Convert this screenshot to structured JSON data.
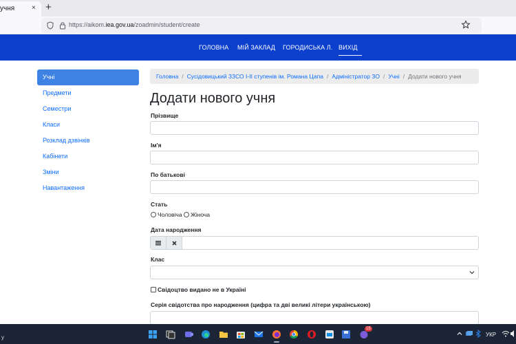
{
  "browser": {
    "tab_title": "учня",
    "tab_close": "×",
    "new_tab": "+",
    "url_prefix": "https://aikom.",
    "url_host": "iea.gov.ua",
    "url_path": "/zoadmin/student/create"
  },
  "nav": {
    "items": [
      "ГОЛОВНА",
      "МІЙ ЗАКЛАД",
      "ГОРОДИСЬКА Л.",
      "ВИХІД"
    ],
    "background": "#0b3fcc"
  },
  "sidebar": {
    "items": [
      "Учні",
      "Предмети",
      "Семестри",
      "Класи",
      "Розклад дзвінків",
      "Кабінети",
      "Зміни",
      "Навантаження"
    ],
    "active_index": 0,
    "active_color": "#3e82e4"
  },
  "breadcrumb": {
    "items": [
      "Головна",
      "Сусідовицький ЗЗСО І-ІІ ступенів ім. Романа Цапа",
      "Адміністратор ЗО",
      "Учні"
    ],
    "current": "Додати нового учня",
    "separator": "/"
  },
  "page": {
    "title": "Додати нового учня"
  },
  "form": {
    "surname_label": "Прізвище",
    "name_label": "Ім'я",
    "patronymic_label": "По батькові",
    "gender_label": "Стать",
    "gender_male": "Чоловіча",
    "gender_female": "Жіноча",
    "birthdate_label": "Дата народження",
    "class_label": "Клас",
    "certificate_abroad_label": "Свідоцтво видано не в Україні",
    "certificate_series_label": "Серія свідотства про народження (цифра та дві великі літери українською)"
  },
  "taskbar": {
    "left_text": "y",
    "lang": "УКР",
    "badge": "15"
  }
}
